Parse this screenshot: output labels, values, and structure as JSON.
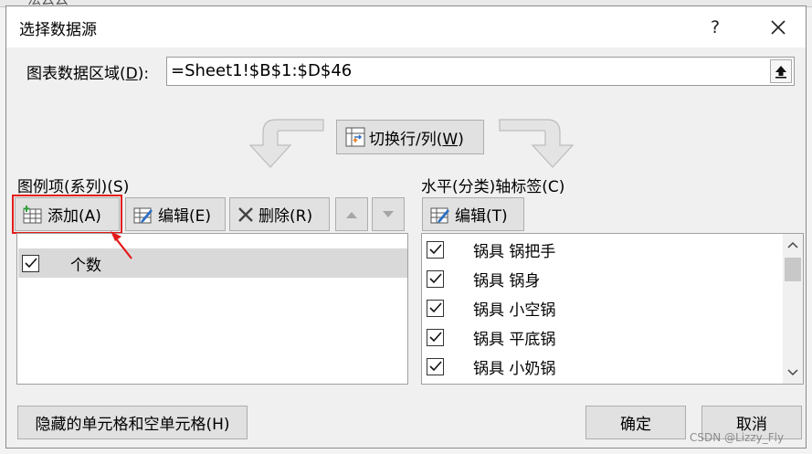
{
  "background": {
    "cell_text": "法云云"
  },
  "dialog": {
    "title": "选择数据源",
    "help_label": "?",
    "data_range_label_prefix": "图表数据区域(",
    "data_range_label_key": "D",
    "data_range_label_suffix": "):",
    "data_range_value": "=Sheet1!$B$1:$D$46",
    "switch_label_prefix": "切换行/列(",
    "switch_label_key": "W",
    "switch_label_suffix": ")"
  },
  "series_panel": {
    "title": "图例项(系列)(S)",
    "add_label": "添加(A)",
    "edit_label": "编辑(E)",
    "delete_label": "删除(R)",
    "items": [
      {
        "label": "个数",
        "checked": true
      }
    ]
  },
  "category_panel": {
    "title": "水平(分类)轴标签(C)",
    "edit_label": "编辑(T)",
    "items": [
      {
        "label": "锅具 锅把手",
        "checked": true
      },
      {
        "label": "锅具 锅身",
        "checked": true
      },
      {
        "label": "锅具 小空锅",
        "checked": true
      },
      {
        "label": "锅具 平底锅",
        "checked": true
      },
      {
        "label": "锅具 小奶锅",
        "checked": true
      }
    ]
  },
  "footer": {
    "hidden_cells_label": "隐藏的单元格和空单元格(H)",
    "ok_label": "确定",
    "cancel_label": "取消"
  },
  "watermark": "CSDN @Lizzy_Fly",
  "colors": {
    "highlight_red": "#e31b1b",
    "button_face": "#e1e1e1",
    "dialog_bg": "#f0f0f0"
  },
  "icons": [
    "close-icon",
    "collapse-range-icon",
    "switch-row-col-icon",
    "add-table-icon",
    "edit-icon",
    "delete-x-icon",
    "move-up-icon",
    "move-down-icon",
    "check-icon",
    "scroll-up-icon",
    "scroll-down-icon"
  ]
}
